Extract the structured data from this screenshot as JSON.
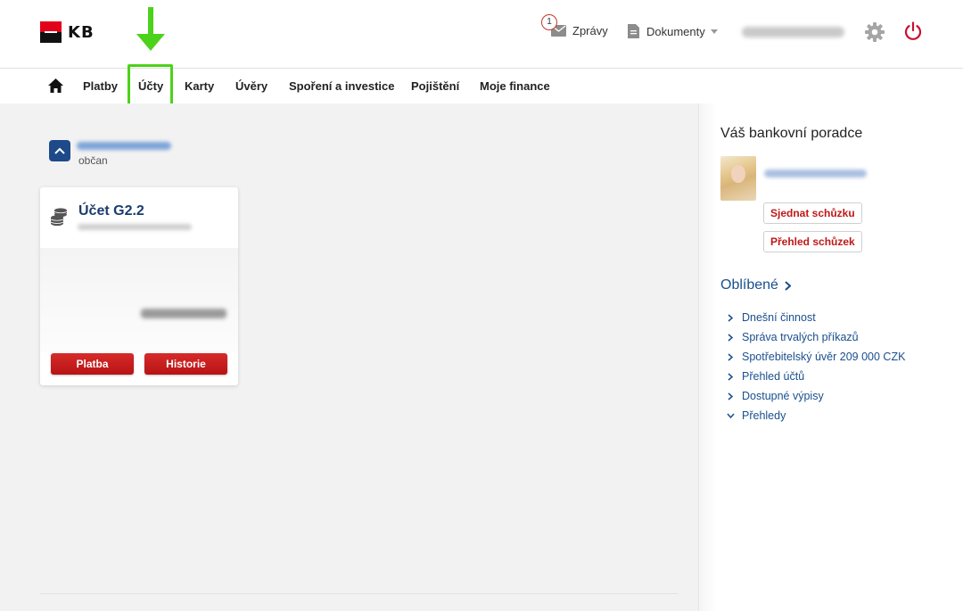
{
  "header": {
    "logo_text": "KB",
    "messages_label": "Zprávy",
    "messages_badge": "1",
    "documents_label": "Dokumenty",
    "icons": [
      "mail-icon",
      "document-icon",
      "gear-icon",
      "power-icon"
    ]
  },
  "nav": {
    "items": [
      {
        "label": "Platby"
      },
      {
        "label": "Účty"
      },
      {
        "label": "Karty"
      },
      {
        "label": "Úvěry"
      },
      {
        "label": "Spoření a investice"
      },
      {
        "label": "Pojištění"
      },
      {
        "label": "Moje finance"
      }
    ],
    "highlighted": "Účty"
  },
  "owner": {
    "role": "občan"
  },
  "account_card": {
    "name": "Účet G2.2",
    "payment_label": "Platba",
    "history_label": "Historie"
  },
  "advisor": {
    "title": "Váš bankovní poradce",
    "schedule_label": "Sjednat schůzku",
    "overview_label": "Přehled schůzek"
  },
  "favorites": {
    "title": "Oblíbené",
    "items": [
      {
        "label": "Dnešní činnost",
        "icon": "chevron-right-icon"
      },
      {
        "label": "Správa trvalých příkazů",
        "icon": "chevron-right-icon"
      },
      {
        "label": "Spotřebitelský úvěr 209 000 CZK",
        "icon": "chevron-right-icon"
      },
      {
        "label": "Přehled účtů",
        "icon": "chevron-right-icon"
      },
      {
        "label": "Dostupné výpisy",
        "icon": "chevron-right-icon"
      },
      {
        "label": "Přehledy",
        "icon": "chevron-down-icon"
      }
    ]
  },
  "colors": {
    "brand_red": "#e2001a",
    "button_red": "#c01818",
    "link_blue": "#1a4f8e",
    "highlight_green": "#4cd21a"
  }
}
